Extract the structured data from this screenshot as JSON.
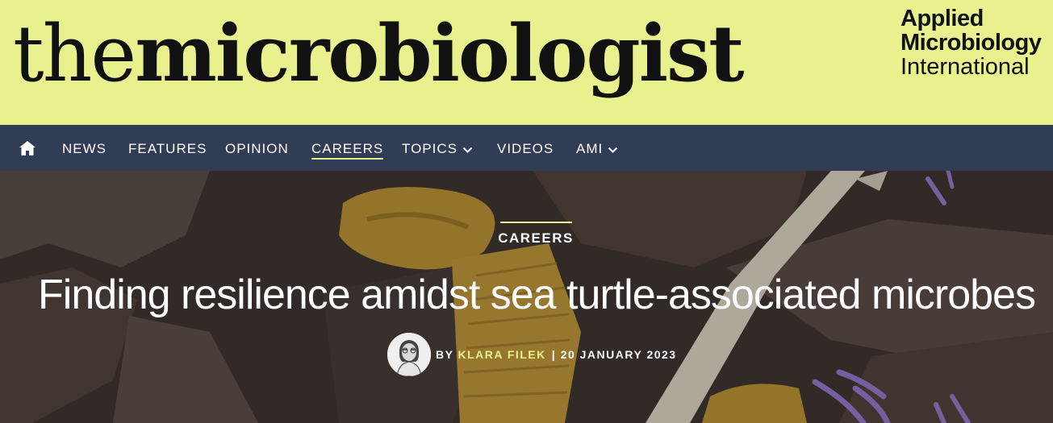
{
  "header": {
    "logo": {
      "light": "the",
      "bold": "microbiologist"
    },
    "partner": {
      "line1": "Applied",
      "line2": "Microbiology",
      "line3": "International"
    },
    "colors": {
      "background": "#e9f18f",
      "text": "#111111"
    }
  },
  "nav": {
    "home_icon": "home-icon",
    "items": [
      {
        "label": "NEWS"
      },
      {
        "label": "FEATURES"
      },
      {
        "label": "OPINION"
      },
      {
        "label": "CAREERS",
        "active": true
      },
      {
        "label": "TOPICS",
        "dropdown": true
      },
      {
        "label": "VIDEOS"
      },
      {
        "label": "AMI",
        "dropdown": true
      }
    ],
    "colors": {
      "background": "#313d55",
      "text": "#ffffff",
      "active_underline": "#e9f18f"
    }
  },
  "hero": {
    "category": "CAREERS",
    "title": "Finding resilience amidst sea turtle-associated microbes",
    "byline": {
      "by": "BY",
      "author": "KLARA FILEK",
      "separator": "|",
      "date": "20 JANUARY 2023"
    },
    "colors": {
      "accent": "#e9f18f",
      "diatom_yellow": "#c9a23a",
      "purple": "#9b7fd8"
    }
  }
}
